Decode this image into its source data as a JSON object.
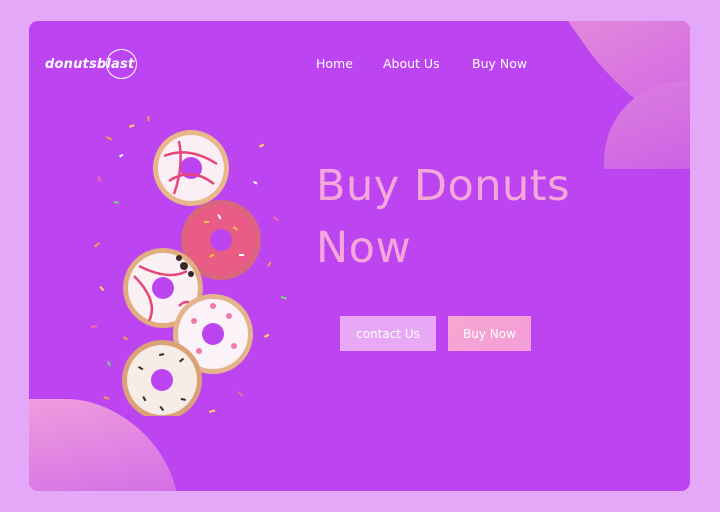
{
  "brand": {
    "logo_text": "donutsblast"
  },
  "nav": {
    "home": "Home",
    "about": "About Us",
    "buy": "Buy Now"
  },
  "hero": {
    "headline_line1": "Buy Donuts",
    "headline_line2": "Now",
    "contact_button": "contact Us",
    "buy_button": "Buy Now",
    "image_icon": "donuts-illustration"
  },
  "colors": {
    "page_background": "#e3a8f7",
    "card_background": "#bd45f1",
    "headline": "#f5a6da",
    "contact_button": "#e7a8f6",
    "buy_button": "#f7a7d1"
  }
}
